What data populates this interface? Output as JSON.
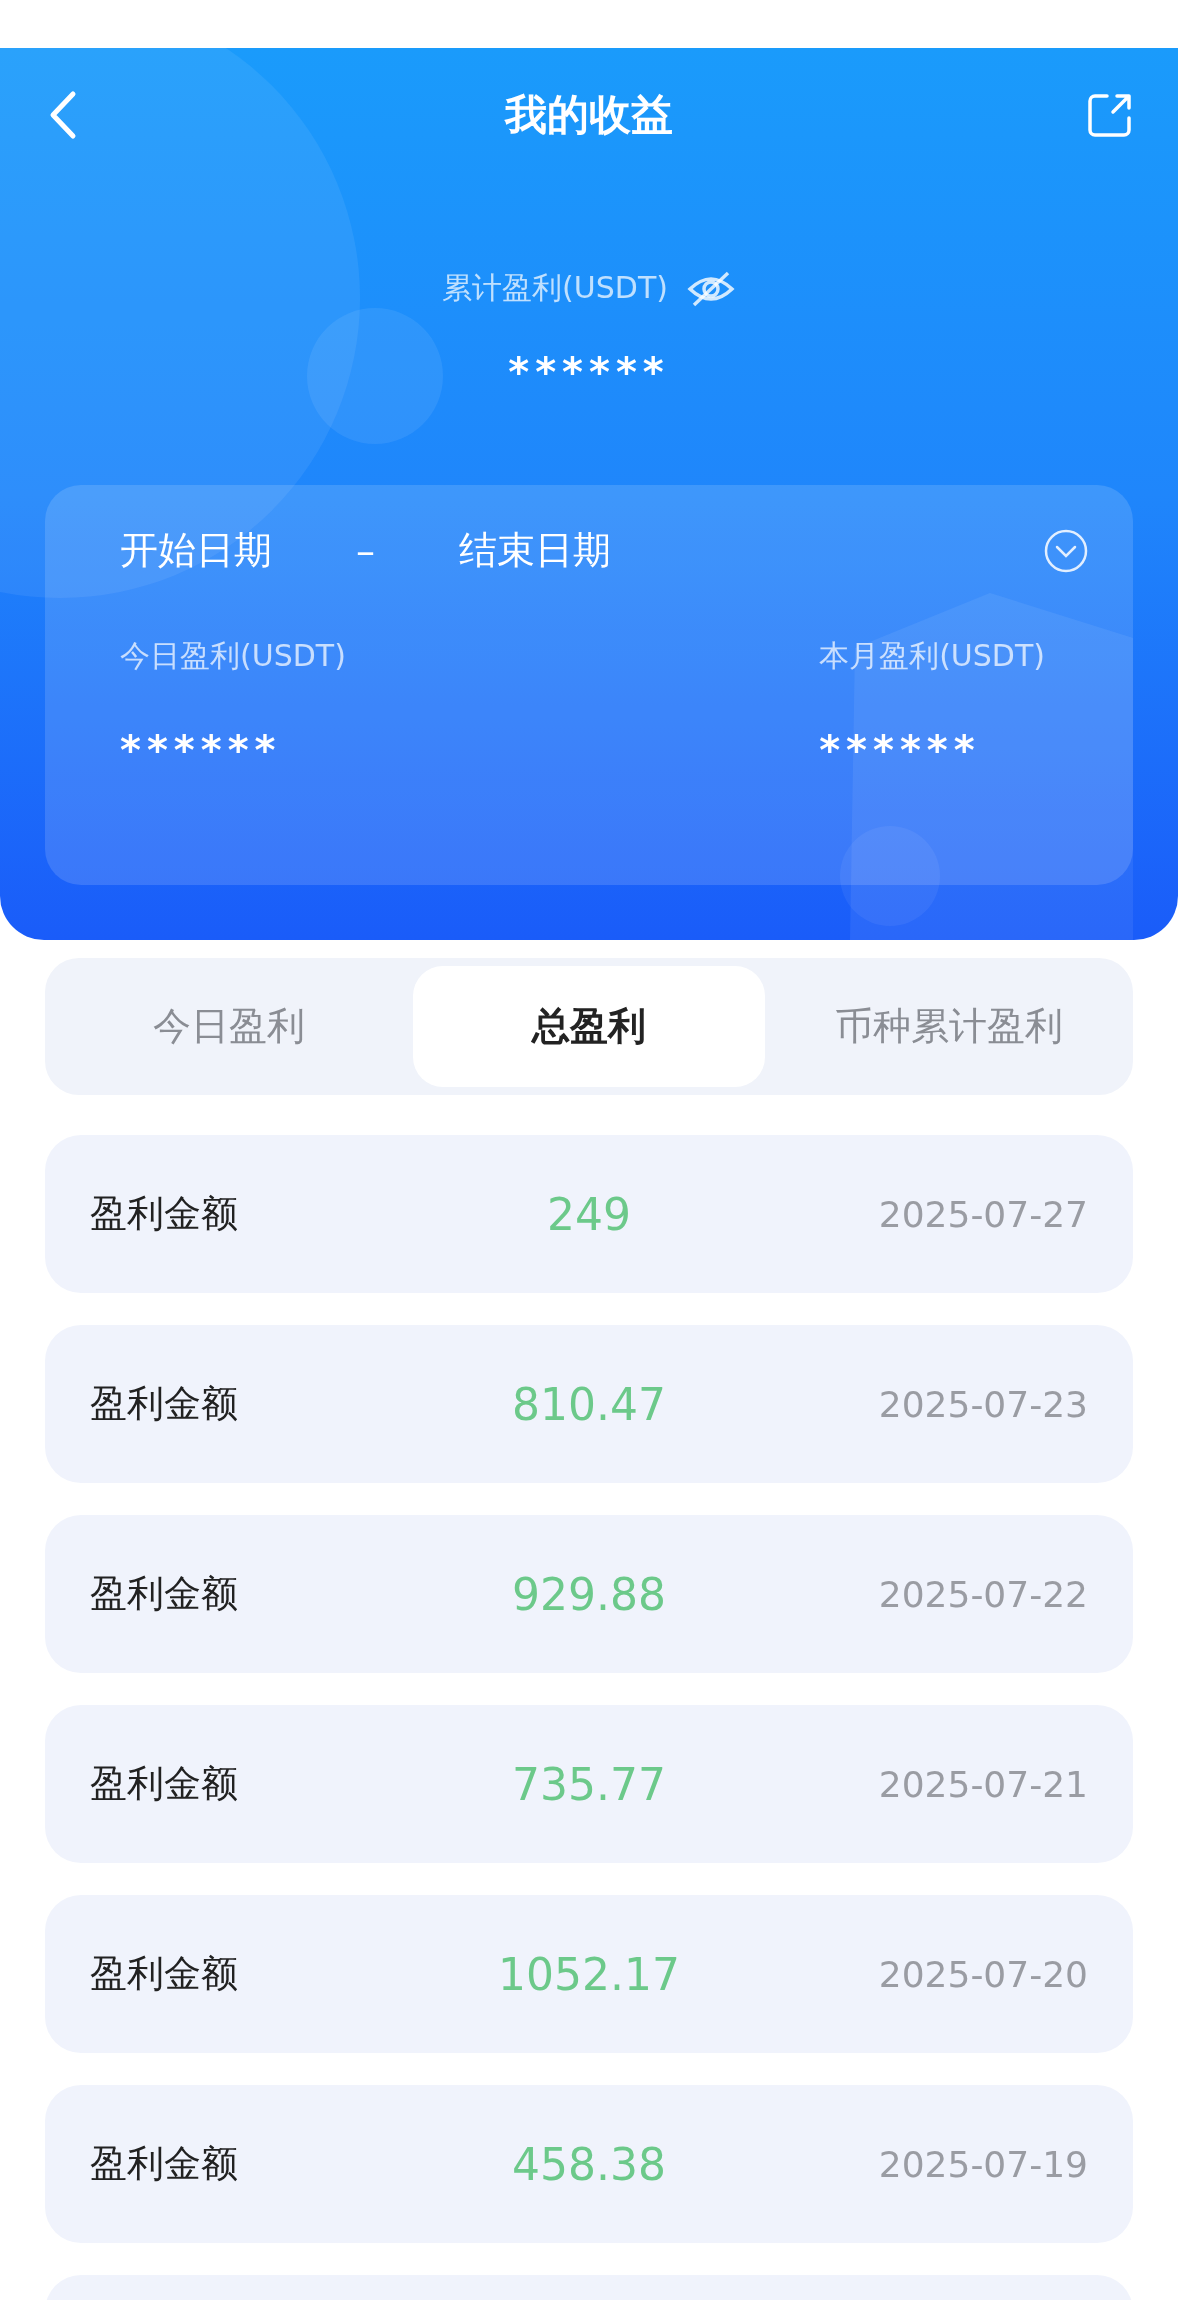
{
  "header": {
    "title": "我的收益",
    "total_label": "累计盈利(USDT)",
    "total_value": "******"
  },
  "date_card": {
    "start": "开始日期",
    "separator": "–",
    "end": "结束日期",
    "today_label": "今日盈利(USDT)",
    "today_value": "******",
    "month_label": "本月盈利(USDT)",
    "month_value": "******"
  },
  "tabs": [
    {
      "label": "今日盈利",
      "selected": false
    },
    {
      "label": "总盈利",
      "selected": true
    },
    {
      "label": "币种累计盈利",
      "selected": false
    }
  ],
  "records": [
    {
      "label": "盈利金额",
      "amount": "249",
      "date": "2025-07-27"
    },
    {
      "label": "盈利金额",
      "amount": "810.47",
      "date": "2025-07-23"
    },
    {
      "label": "盈利金额",
      "amount": "929.88",
      "date": "2025-07-22"
    },
    {
      "label": "盈利金额",
      "amount": "735.77",
      "date": "2025-07-21"
    },
    {
      "label": "盈利金额",
      "amount": "1052.17",
      "date": "2025-07-20"
    },
    {
      "label": "盈利金额",
      "amount": "458.38",
      "date": "2025-07-19"
    }
  ]
}
